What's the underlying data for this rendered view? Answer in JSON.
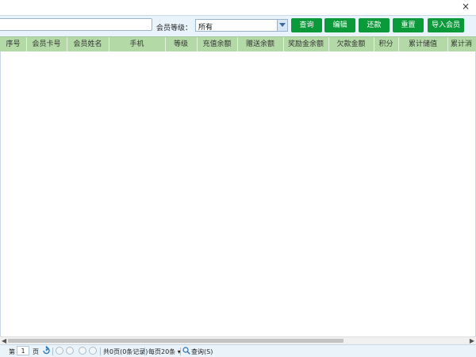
{
  "window": {
    "close_glyph": "×"
  },
  "toolbar": {
    "search_value": "",
    "level_label": "会员等级：",
    "level_value": "所有",
    "buttons": [
      "查询",
      "编辑",
      "还款",
      "重置",
      "导入会员"
    ]
  },
  "grid": {
    "columns": [
      "序号",
      "会员卡号",
      "会员姓名",
      "手机",
      "等级",
      "充值余额",
      "赠送余额",
      "奖励金余额",
      "欠款金额",
      "积分",
      "累计储值",
      "累计消"
    ]
  },
  "pager": {
    "page_prefix": "第",
    "page_number": "1",
    "page_suffix": "页",
    "total_text": "共0页(0条记录)",
    "per_page_text": "每页20条 ▾",
    "query_text": "查询(S)"
  },
  "colors": {
    "button_green": "#0a9a3a",
    "header_green": "#b3d9a6",
    "toolbar_bg": "#e9f3fb"
  }
}
